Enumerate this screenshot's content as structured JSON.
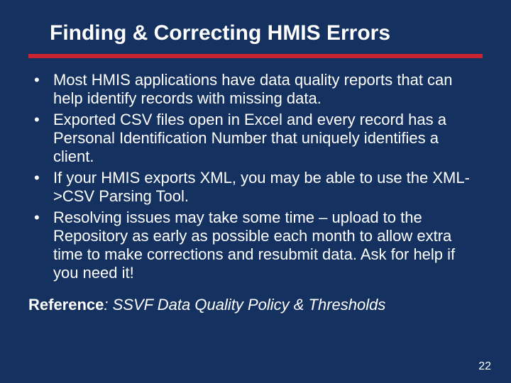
{
  "title": "Finding & Correcting HMIS Errors",
  "bullets": [
    "Most HMIS applications have data quality reports that can help identify records with missing data.",
    "Exported CSV files open in Excel and every record has a Personal Identification Number that uniquely identifies a client.",
    "If your HMIS exports XML, you may be able to use the XML->CSV Parsing Tool.",
    "Resolving issues may take some time – upload to the Repository as early as possible each month to allow extra time to make corrections and resubmit data.  Ask for help if you need it!"
  ],
  "reference": {
    "label": "Reference",
    "text": ": SSVF Data Quality Policy & Thresholds"
  },
  "page_number": "22"
}
